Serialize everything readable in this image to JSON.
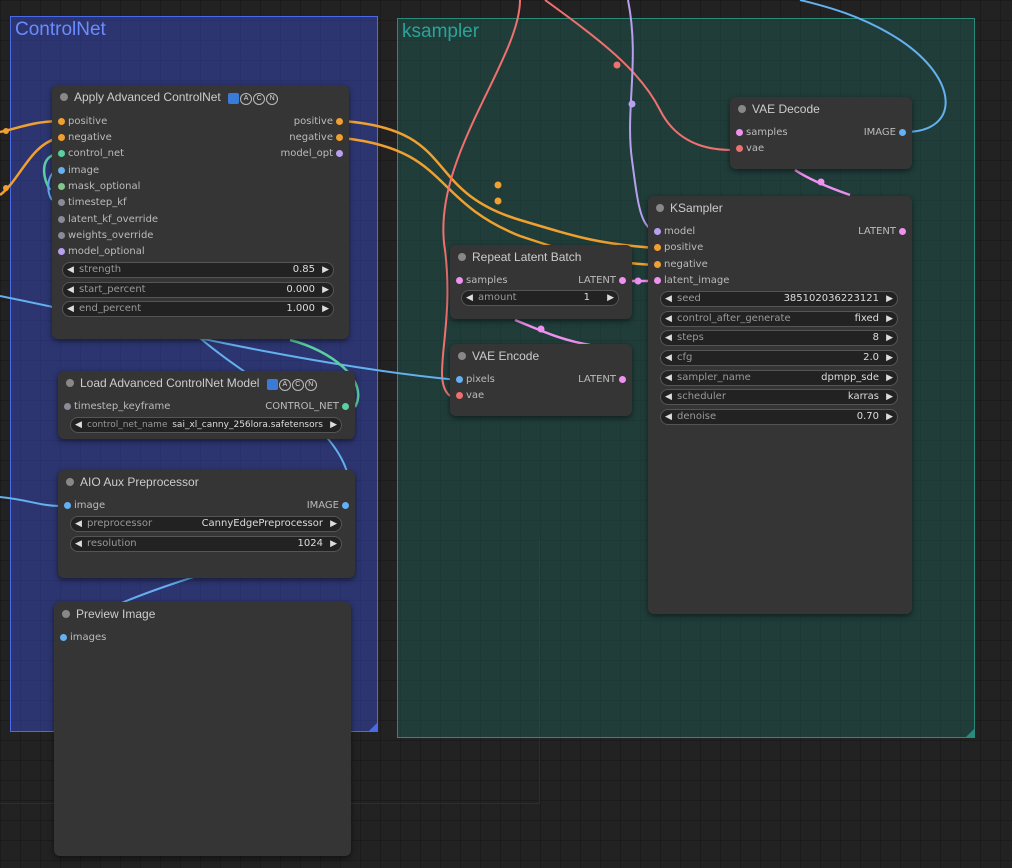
{
  "groups": {
    "controlnet": "ControlNet",
    "ksampler": "ksampler"
  },
  "colors": {
    "positive_wire": "#f0a030",
    "image_wire": "#64b0f0",
    "vae_wire": "#f07070",
    "model_wire": "#b8a0f0",
    "latent_wire": "#f090f0",
    "control_net_wire": "#5ad0a0"
  },
  "apply_cn": {
    "title": "Apply Advanced ControlNet",
    "badges": [
      "A",
      "C",
      "N"
    ],
    "inputs": [
      "positive",
      "negative",
      "control_net",
      "image",
      "mask_optional",
      "timestep_kf",
      "latent_kf_override",
      "weights_override",
      "model_optional"
    ],
    "outputs": [
      "positive",
      "negative",
      "model_opt"
    ],
    "widgets": [
      {
        "label": "strength",
        "value": "0.85"
      },
      {
        "label": "start_percent",
        "value": "0.000"
      },
      {
        "label": "end_percent",
        "value": "1.000"
      }
    ]
  },
  "load_cn": {
    "title": "Load Advanced ControlNet Model",
    "badges": [
      "A",
      "C",
      "N"
    ],
    "input": "timestep_keyframe",
    "output": "CONTROL_NET",
    "widget": {
      "label": "control_net_name",
      "value": "sai_xl_canny_256lora.safetensors"
    }
  },
  "aio": {
    "title": "AIO Aux Preprocessor",
    "input": "image",
    "output": "IMAGE",
    "widgets": [
      {
        "label": "preprocessor",
        "value": "CannyEdgePreprocessor"
      },
      {
        "label": "resolution",
        "value": "1024"
      }
    ]
  },
  "preview": {
    "title": "Preview Image",
    "input": "images"
  },
  "repeat": {
    "title": "Repeat Latent Batch",
    "input": "samples",
    "output": "LATENT",
    "widget": {
      "label": "amount",
      "value": "1"
    }
  },
  "vae_encode": {
    "title": "VAE Encode",
    "inputs": [
      "pixels",
      "vae"
    ],
    "output": "LATENT"
  },
  "vae_decode": {
    "title": "VAE Decode",
    "inputs": [
      "samples",
      "vae"
    ],
    "output": "IMAGE"
  },
  "ksampler": {
    "title": "KSampler",
    "inputs": [
      "model",
      "positive",
      "negative",
      "latent_image"
    ],
    "output": "LATENT",
    "widgets": [
      {
        "label": "seed",
        "value": "385102036223121"
      },
      {
        "label": "control_after_generate",
        "value": "fixed"
      },
      {
        "label": "steps",
        "value": "8"
      },
      {
        "label": "cfg",
        "value": "2.0"
      },
      {
        "label": "sampler_name",
        "value": "dpmpp_sde"
      },
      {
        "label": "scheduler",
        "value": "karras"
      },
      {
        "label": "denoise",
        "value": "0.70"
      }
    ]
  }
}
